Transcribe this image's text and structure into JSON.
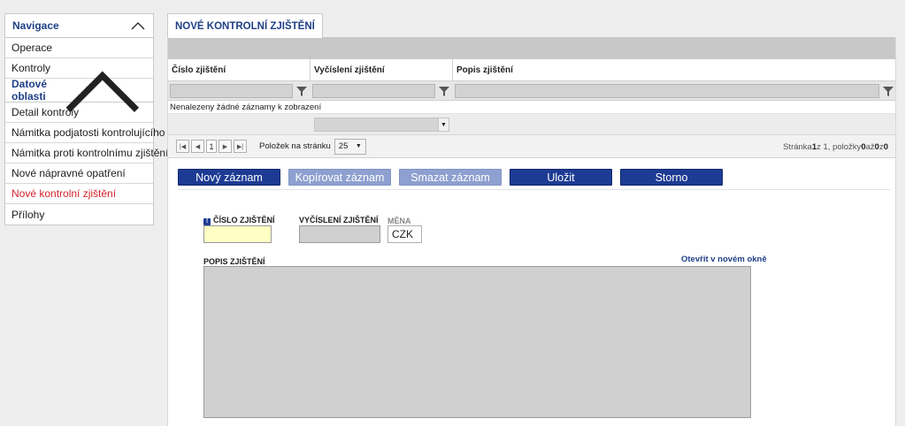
{
  "sidebar": {
    "nav_title": "Navigace",
    "nav_items": [
      {
        "label": "Operace"
      },
      {
        "label": "Kontroly"
      }
    ],
    "data_title": "Datové oblasti",
    "data_items": [
      {
        "label": "Detail kontroly"
      },
      {
        "label": "Námitka podjatosti kontrolujícího"
      },
      {
        "label": "Námitka proti kontrolnímu zjištění"
      },
      {
        "label": "Nové nápravné opatření"
      },
      {
        "label": "Nové kontrolní zjištění"
      },
      {
        "label": "Přílohy"
      }
    ],
    "active_item": "Nové kontrolní zjištění",
    "active_color": "#d2232a"
  },
  "tab": {
    "title": "NOVÉ KONTROLNÍ ZJIŠTĚNÍ"
  },
  "grid": {
    "columns": [
      "Číslo zjištění",
      "Vyčíslení zjištění",
      "Popis zjištění"
    ],
    "empty_text": "Nenalezeny žádné záznamy k zobrazení"
  },
  "pager": {
    "page": "1",
    "per_page_label": "Položek na stránku",
    "per_page_value": "25",
    "info_prefix": "Stránka ",
    "info_page": "1",
    "info_mid": " z 1, položky ",
    "info_from": "0",
    "info_to_word": " až ",
    "info_to": "0",
    "info_of": " z ",
    "info_total": "0"
  },
  "toolbar": {
    "new": "Nový záznam",
    "copy": "Kopírovat záznam",
    "delete": "Smazat záznam",
    "save": "Uložit",
    "cancel": "Storno"
  },
  "form": {
    "cislo_label": "ČÍSLO ZJIŠTĚNÍ",
    "cislo_value": "",
    "vycisleni_label": "VYČÍSLENÍ ZJIŠTĚNÍ",
    "vycisleni_value": "",
    "mena_label": "MĚNA",
    "mena_value": "CZK",
    "popis_label": "POPIS ZJIŠTĚNÍ",
    "popis_value": "",
    "open_window": "Otevřít v novém okně"
  },
  "colors": {
    "brand_blue": "#1d3b93",
    "required_yellow": "#ffffc4"
  }
}
